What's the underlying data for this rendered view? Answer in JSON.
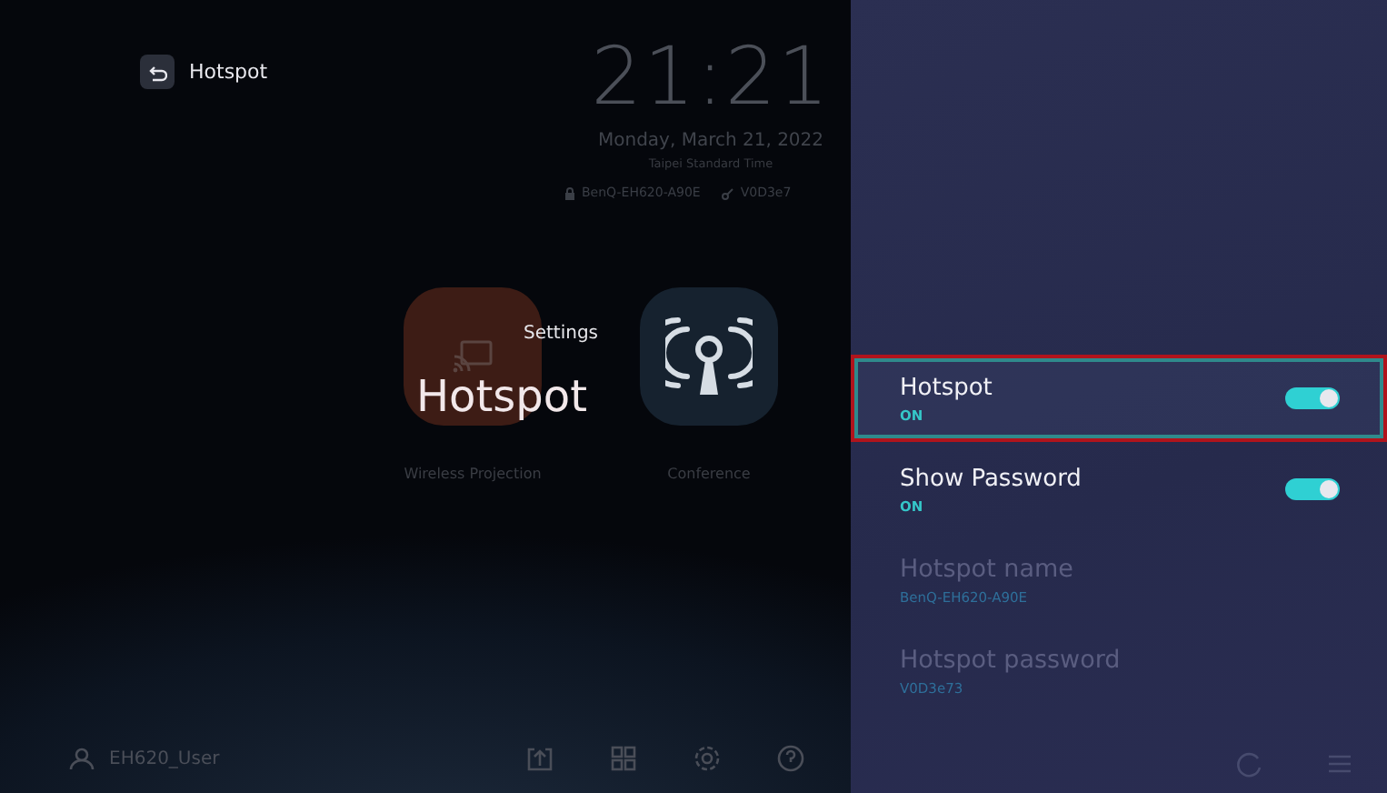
{
  "back_button": {
    "label": "Hotspot"
  },
  "clock": {
    "time": "21:21",
    "date": "Monday, March 21, 2022",
    "timezone": "Taipei Standard Time",
    "network_name": "BenQ-EH620-A90E",
    "network_password": "V0D3e7"
  },
  "apps": [
    {
      "label": "Wireless Projection",
      "kind": "cast"
    },
    {
      "label": "Conference",
      "kind": "antenna"
    }
  ],
  "transition": {
    "caption": "Settings",
    "title": "Hotspot"
  },
  "settings": [
    {
      "kind": "toggle",
      "title": "Hotspot",
      "value": "ON",
      "on": true,
      "selected": true,
      "disabled": false
    },
    {
      "kind": "toggle",
      "title": "Show Password",
      "value": "ON",
      "on": true,
      "selected": false,
      "disabled": false
    },
    {
      "kind": "info",
      "title": "Hotspot name",
      "value": "BenQ-EH620-A90E",
      "selected": false,
      "disabled": true
    },
    {
      "kind": "info",
      "title": "Hotspot password",
      "value": "V0D3e73",
      "selected": false,
      "disabled": true
    }
  ],
  "bottom_bar": {
    "user": "EH620_User"
  }
}
